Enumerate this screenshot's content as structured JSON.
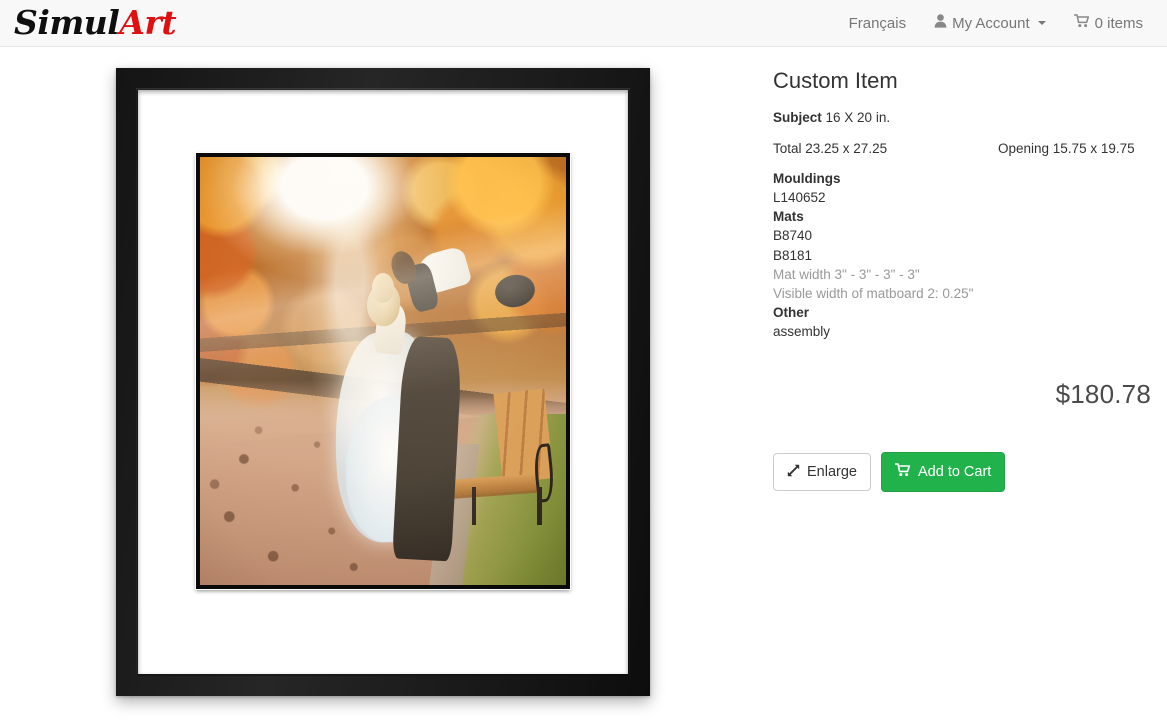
{
  "header": {
    "logo": {
      "part1": "Simul",
      "part2": "Art"
    },
    "nav": [
      {
        "label": "Français",
        "icon": null,
        "name": "nav-language-french"
      },
      {
        "label": "My Account",
        "icon": "user-icon",
        "caret": true,
        "name": "nav-my-account"
      },
      {
        "label": "0 items",
        "icon": "shopping-cart-icon",
        "name": "nav-cart"
      }
    ]
  },
  "artwork": {
    "alt": "Framed wedding photograph of a couple in an autumn park",
    "frame_color": "#1a1a1a",
    "mat_color": "#ffffff",
    "inner_mat_color": "#0a0a0a"
  },
  "panel": {
    "title": "Custom Item",
    "subject_label": "Subject",
    "subject_value": "16 X 20 in.",
    "total_label": "Total 23.25 x 27.25",
    "opening_label": "Opening 15.75 x 19.75",
    "groups": [
      {
        "heading": "Mouldings",
        "items": [
          {
            "text": "L140652",
            "muted": false
          }
        ]
      },
      {
        "heading": "Mats",
        "items": [
          {
            "text": "B8740",
            "muted": false
          },
          {
            "text": "B8181",
            "muted": false
          },
          {
            "text": "Mat width 3\" - 3\" - 3\" - 3\"",
            "muted": true
          },
          {
            "text": "Visible width of matboard 2: 0.25\"",
            "muted": true
          }
        ]
      },
      {
        "heading": "Other",
        "items": [
          {
            "text": "assembly",
            "muted": false
          }
        ]
      }
    ],
    "price": "$180.78",
    "buttons": {
      "enlarge": {
        "label": "Enlarge",
        "icon": "expand-arrows-icon"
      },
      "add_to_cart": {
        "label": "Add to Cart",
        "icon": "shopping-cart-icon",
        "color": "#22b24c"
      }
    }
  }
}
